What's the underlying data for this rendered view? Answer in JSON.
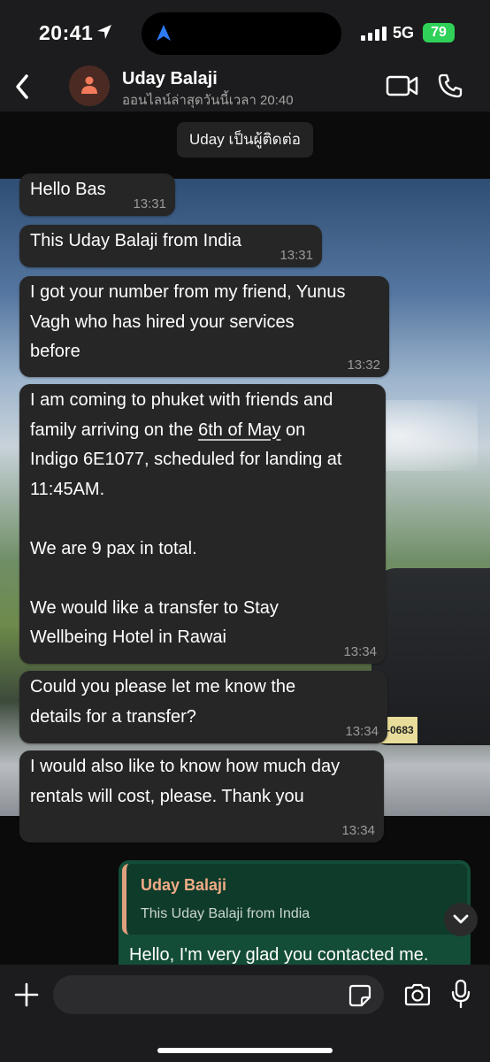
{
  "status_bar": {
    "time": "20:41",
    "network": "5G",
    "battery": "79"
  },
  "header": {
    "contact_name": "Uday Balaji",
    "contact_status": "ออนไลน์ล่าสุดวันนี้เวลา 20:40"
  },
  "system_note": "Uday เป็นผู้ติดต่อ",
  "messages": [
    {
      "text": "Hello Bas",
      "time": "13:31"
    },
    {
      "text": "This Uday Balaji from India",
      "time": "13:31"
    },
    {
      "text": "I got your number from my friend, Yunus\nVagh who has hired your services\nbefore",
      "time": "13:32"
    },
    {
      "text_before": "I am coming to phuket with friends and\nfamily arriving on the ",
      "link": "6th of May",
      "text_after": " on\nIndigo 6E1077, scheduled for landing at\n11:45AM.\n\nWe are 9 pax in total.\n\nWe would like a transfer to Stay\nWellbeing Hotel in Rawai",
      "time": "13:34"
    },
    {
      "text": "Could you please let me know the\ndetails for a transfer?",
      "time": "13:34"
    },
    {
      "text": "I would also like to know how much day\nrentals will cost, please. Thank you",
      "time": "13:34"
    }
  ],
  "reply": {
    "quoted_name": "Uday Balaji",
    "quoted_text": "This Uday Balaji from India",
    "text": "Hello, I'm very glad you contacted me."
  },
  "wallpaper": {
    "plate_text": "0-0683"
  },
  "colors": {
    "incoming_bubble": "#262626",
    "outgoing_bubble": "#144d37",
    "quote_accent": "#e0a07e",
    "battery": "#30d158"
  },
  "icons": [
    "location-arrow-icon",
    "navigation-icon",
    "signal-icon",
    "back-icon",
    "person-icon",
    "video-call-icon",
    "phone-icon",
    "chevron-down-icon",
    "plus-icon",
    "sticker-icon",
    "camera-icon",
    "mic-icon"
  ]
}
